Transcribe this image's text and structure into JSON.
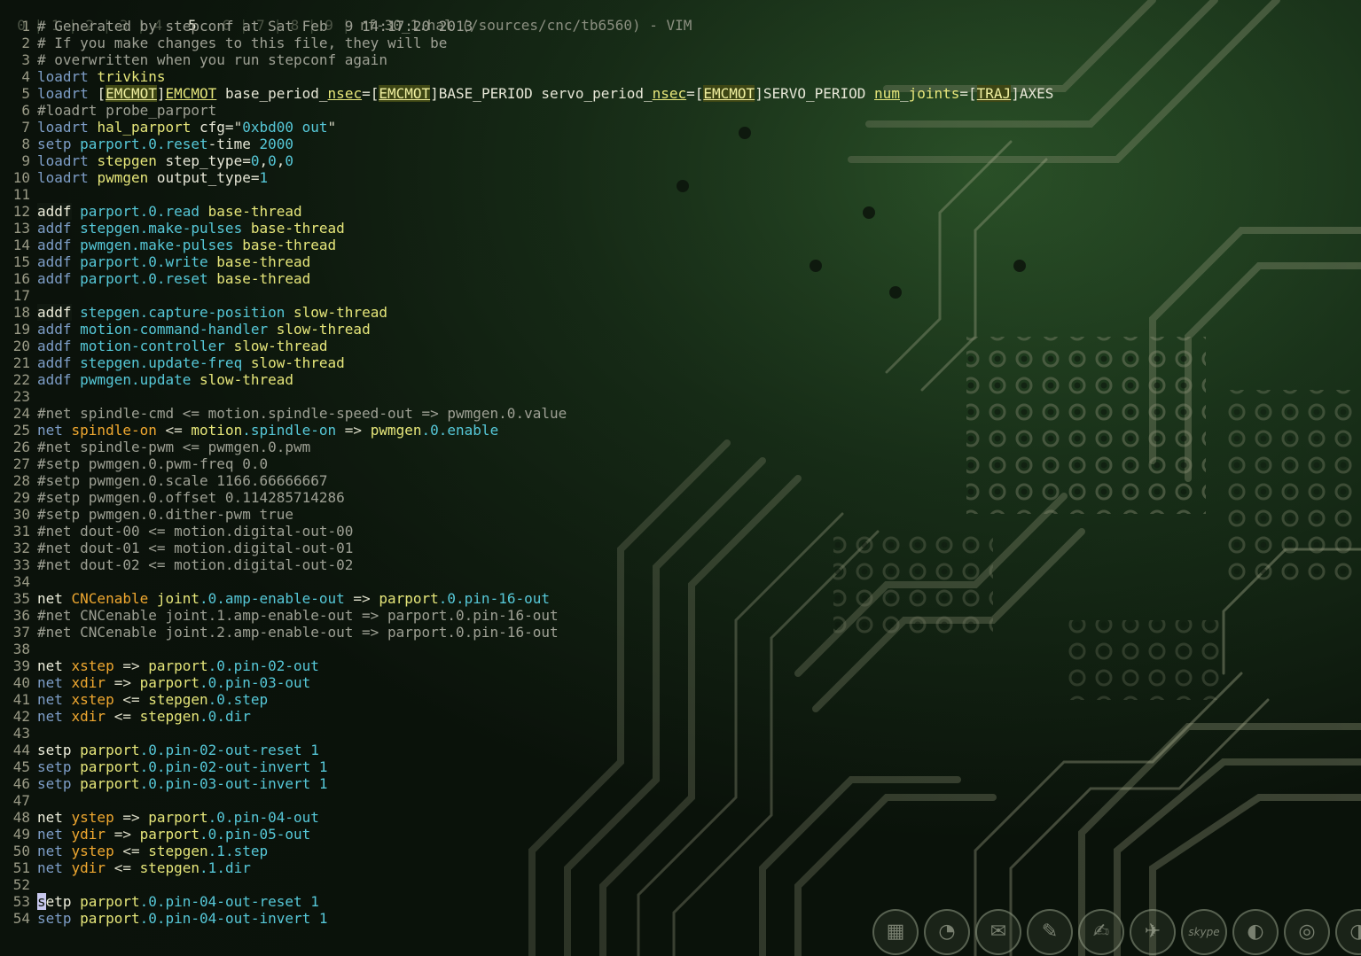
{
  "window": {
    "workspaces": [
      "0",
      "1",
      "2",
      "3",
      "4",
      "5",
      "6",
      "7",
      "8",
      "9"
    ],
    "active_workspace": "5",
    "title": "rf-30_1.hal (/sources/cnc/tb6560) - VIM"
  },
  "editor": {
    "lines": [
      {
        "n": "1",
        "tokens": [
          {
            "t": "# Generated by stepconf at Sat Feb  9 14:17:20 2013",
            "c": "comment"
          }
        ]
      },
      {
        "n": "2",
        "tokens": [
          {
            "t": "# If you make changes to this file, they will be",
            "c": "comment"
          }
        ]
      },
      {
        "n": "3",
        "tokens": [
          {
            "t": "# overwritten when you run stepconf again",
            "c": "comment"
          }
        ]
      },
      {
        "n": "4",
        "tokens": [
          {
            "t": "loadrt ",
            "c": "kw"
          },
          {
            "t": "trivkins",
            "c": "thread"
          }
        ]
      },
      {
        "n": "5",
        "tokens": [
          {
            "t": "loadrt ",
            "c": "kw"
          },
          {
            "t": "[",
            "c": "plain"
          },
          {
            "t": "EMCMOT",
            "c": "hl"
          },
          {
            "t": "]",
            "c": "plain"
          },
          {
            "t": "EMCMOT",
            "c": "ul"
          },
          {
            "t": " base_period_",
            "c": "plain"
          },
          {
            "t": "nsec",
            "c": "ul"
          },
          {
            "t": "=[",
            "c": "plain"
          },
          {
            "t": "EMCMOT",
            "c": "hl"
          },
          {
            "t": "]BASE_PERIOD servo_period_",
            "c": "plain"
          },
          {
            "t": "nsec",
            "c": "ul"
          },
          {
            "t": "=[",
            "c": "plain"
          },
          {
            "t": "EMCMOT",
            "c": "hl"
          },
          {
            "t": "]SERVO_PERIOD ",
            "c": "plain"
          },
          {
            "t": "num",
            "c": "ul"
          },
          {
            "t": "_",
            "c": "plain"
          },
          {
            "t": "joints",
            "c": "thread"
          },
          {
            "t": "=[",
            "c": "plain"
          },
          {
            "t": "TRAJ",
            "c": "hl"
          },
          {
            "t": "]AXES",
            "c": "plain"
          }
        ]
      },
      {
        "n": "6",
        "tokens": [
          {
            "t": "#loadrt probe_parport",
            "c": "comment"
          }
        ]
      },
      {
        "n": "7",
        "tokens": [
          {
            "t": "loadrt ",
            "c": "kw"
          },
          {
            "t": "hal_parport ",
            "c": "thread"
          },
          {
            "t": "cfg=",
            "c": "plain"
          },
          {
            "t": "\"",
            "c": "str"
          },
          {
            "t": "0xbd00 ",
            "c": "num"
          },
          {
            "t": "out",
            "c": "id"
          },
          {
            "t": "\"",
            "c": "str"
          }
        ]
      },
      {
        "n": "8",
        "tokens": [
          {
            "t": "setp ",
            "c": "kw"
          },
          {
            "t": "parport.0.reset",
            "c": "id"
          },
          {
            "t": "-time ",
            "c": "plain"
          },
          {
            "t": "2000",
            "c": "num"
          }
        ]
      },
      {
        "n": "9",
        "tokens": [
          {
            "t": "loadrt ",
            "c": "kw"
          },
          {
            "t": "stepgen ",
            "c": "thread"
          },
          {
            "t": "step_type=",
            "c": "plain"
          },
          {
            "t": "0",
            "c": "num"
          },
          {
            "t": ",",
            "c": "plain"
          },
          {
            "t": "0",
            "c": "num"
          },
          {
            "t": ",",
            "c": "plain"
          },
          {
            "t": "0",
            "c": "num"
          }
        ]
      },
      {
        "n": "10",
        "tokens": [
          {
            "t": "loadrt ",
            "c": "kw"
          },
          {
            "t": "pwmgen ",
            "c": "thread"
          },
          {
            "t": "output_type=",
            "c": "plain"
          },
          {
            "t": "1",
            "c": "num"
          }
        ]
      },
      {
        "n": "11",
        "tokens": []
      },
      {
        "n": "12",
        "tokens": [
          {
            "t": "addf",
            "c": "addf"
          },
          {
            "t": " ",
            "c": "plain"
          },
          {
            "t": "parport.0.read ",
            "c": "id"
          },
          {
            "t": "base-thread",
            "c": "thread"
          }
        ]
      },
      {
        "n": "13",
        "tokens": [
          {
            "t": "addf ",
            "c": "kw"
          },
          {
            "t": "stepgen.make-pulses ",
            "c": "id"
          },
          {
            "t": "base-thread",
            "c": "thread"
          }
        ]
      },
      {
        "n": "14",
        "tokens": [
          {
            "t": "addf ",
            "c": "kw"
          },
          {
            "t": "pwmgen.make-pulses ",
            "c": "id"
          },
          {
            "t": "base-thread",
            "c": "thread"
          }
        ]
      },
      {
        "n": "15",
        "tokens": [
          {
            "t": "addf ",
            "c": "kw"
          },
          {
            "t": "parport.0.write ",
            "c": "id"
          },
          {
            "t": "base-thread",
            "c": "thread"
          }
        ]
      },
      {
        "n": "16",
        "tokens": [
          {
            "t": "addf ",
            "c": "kw"
          },
          {
            "t": "parport.0.reset ",
            "c": "id"
          },
          {
            "t": "base-thread",
            "c": "thread"
          }
        ]
      },
      {
        "n": "17",
        "tokens": []
      },
      {
        "n": "18",
        "tokens": [
          {
            "t": "addf",
            "c": "addf"
          },
          {
            "t": " ",
            "c": "plain"
          },
          {
            "t": "stepgen.capture-position ",
            "c": "id"
          },
          {
            "t": "slow-thread",
            "c": "thread"
          }
        ]
      },
      {
        "n": "19",
        "tokens": [
          {
            "t": "addf ",
            "c": "kw"
          },
          {
            "t": "motion-command-handler ",
            "c": "id"
          },
          {
            "t": "slow-thread",
            "c": "thread"
          }
        ]
      },
      {
        "n": "20",
        "tokens": [
          {
            "t": "addf ",
            "c": "kw"
          },
          {
            "t": "motion-controller ",
            "c": "id"
          },
          {
            "t": "slow-thread",
            "c": "thread"
          }
        ]
      },
      {
        "n": "21",
        "tokens": [
          {
            "t": "addf ",
            "c": "kw"
          },
          {
            "t": "stepgen.update-freq ",
            "c": "id"
          },
          {
            "t": "slow-thread",
            "c": "thread"
          }
        ]
      },
      {
        "n": "22",
        "tokens": [
          {
            "t": "addf ",
            "c": "kw"
          },
          {
            "t": "pwmgen.update ",
            "c": "id"
          },
          {
            "t": "slow-thread",
            "c": "thread"
          }
        ]
      },
      {
        "n": "23",
        "tokens": []
      },
      {
        "n": "24",
        "tokens": [
          {
            "t": "#net spindle-cmd <= motion.spindle-speed-out => pwmgen.0.value",
            "c": "comment"
          }
        ]
      },
      {
        "n": "25",
        "tokens": [
          {
            "t": "net ",
            "c": "kw"
          },
          {
            "t": "spindle-on ",
            "c": "sig"
          },
          {
            "t": "<= ",
            "c": "op"
          },
          {
            "t": "motion",
            "c": "thread"
          },
          {
            "t": ".spindle-on ",
            "c": "id"
          },
          {
            "t": "=> ",
            "c": "op"
          },
          {
            "t": "pwmgen",
            "c": "thread"
          },
          {
            "t": ".0.enable",
            "c": "id"
          }
        ]
      },
      {
        "n": "26",
        "tokens": [
          {
            "t": "#net spindle-pwm <= pwmgen.0.pwm",
            "c": "comment"
          }
        ]
      },
      {
        "n": "27",
        "tokens": [
          {
            "t": "#setp pwmgen.0.pwm-freq 0.0",
            "c": "comment"
          }
        ]
      },
      {
        "n": "28",
        "tokens": [
          {
            "t": "#setp pwmgen.0.scale 1166.66666667",
            "c": "comment"
          }
        ]
      },
      {
        "n": "29",
        "tokens": [
          {
            "t": "#setp pwmgen.0.offset 0.114285714286",
            "c": "comment"
          }
        ]
      },
      {
        "n": "30",
        "tokens": [
          {
            "t": "#setp pwmgen.0.dither-pwm true",
            "c": "comment"
          }
        ]
      },
      {
        "n": "31",
        "tokens": [
          {
            "t": "#net dout-00 <= motion.digital-out-00",
            "c": "comment"
          }
        ]
      },
      {
        "n": "32",
        "tokens": [
          {
            "t": "#net dout-01 <= motion.digital-out-01",
            "c": "comment"
          }
        ]
      },
      {
        "n": "33",
        "tokens": [
          {
            "t": "#net dout-02 <= motion.digital-out-02",
            "c": "comment"
          }
        ]
      },
      {
        "n": "34",
        "tokens": []
      },
      {
        "n": "35",
        "tokens": [
          {
            "t": "net ",
            "c": "cmd"
          },
          {
            "t": "CNCenable ",
            "c": "sig"
          },
          {
            "t": "joint",
            "c": "thread"
          },
          {
            "t": ".0.amp-enable-out ",
            "c": "id"
          },
          {
            "t": "=> ",
            "c": "op"
          },
          {
            "t": "parport",
            "c": "thread"
          },
          {
            "t": ".0.pin-16-out",
            "c": "id"
          }
        ]
      },
      {
        "n": "36",
        "tokens": [
          {
            "t": "#net CNCenable joint.1.amp-enable-out => parport.0.pin-16-out",
            "c": "comment"
          }
        ]
      },
      {
        "n": "37",
        "tokens": [
          {
            "t": "#net CNCenable joint.2.amp-enable-out => parport.0.pin-16-out",
            "c": "comment"
          }
        ]
      },
      {
        "n": "38",
        "tokens": []
      },
      {
        "n": "39",
        "tokens": [
          {
            "t": "net ",
            "c": "cmd"
          },
          {
            "t": "xstep ",
            "c": "sig"
          },
          {
            "t": "=> ",
            "c": "op"
          },
          {
            "t": "parport",
            "c": "thread"
          },
          {
            "t": ".0.pin-02-out",
            "c": "id"
          }
        ]
      },
      {
        "n": "40",
        "tokens": [
          {
            "t": "net ",
            "c": "kw"
          },
          {
            "t": "xdir ",
            "c": "sig"
          },
          {
            "t": "=> ",
            "c": "op"
          },
          {
            "t": "parport",
            "c": "thread"
          },
          {
            "t": ".0.pin-03-out",
            "c": "id"
          }
        ]
      },
      {
        "n": "41",
        "tokens": [
          {
            "t": "net ",
            "c": "kw"
          },
          {
            "t": "xstep ",
            "c": "sig"
          },
          {
            "t": "<= ",
            "c": "op"
          },
          {
            "t": "stepgen",
            "c": "thread"
          },
          {
            "t": ".0.step",
            "c": "id"
          }
        ]
      },
      {
        "n": "42",
        "tokens": [
          {
            "t": "net ",
            "c": "kw"
          },
          {
            "t": "xdir ",
            "c": "sig"
          },
          {
            "t": "<= ",
            "c": "op"
          },
          {
            "t": "stepgen",
            "c": "thread"
          },
          {
            "t": ".0.dir",
            "c": "id"
          }
        ]
      },
      {
        "n": "43",
        "tokens": []
      },
      {
        "n": "44",
        "tokens": [
          {
            "t": "setp ",
            "c": "cmd"
          },
          {
            "t": "parport",
            "c": "thread"
          },
          {
            "t": ".0.pin-02-out-reset ",
            "c": "id"
          },
          {
            "t": "1",
            "c": "num"
          }
        ]
      },
      {
        "n": "45",
        "tokens": [
          {
            "t": "setp ",
            "c": "kw"
          },
          {
            "t": "parport",
            "c": "thread"
          },
          {
            "t": ".0.pin-02-out-invert ",
            "c": "id"
          },
          {
            "t": "1",
            "c": "num"
          }
        ]
      },
      {
        "n": "46",
        "tokens": [
          {
            "t": "setp ",
            "c": "kw"
          },
          {
            "t": "parport",
            "c": "thread"
          },
          {
            "t": ".0.pin-03-out-invert ",
            "c": "id"
          },
          {
            "t": "1",
            "c": "num"
          }
        ]
      },
      {
        "n": "47",
        "tokens": []
      },
      {
        "n": "48",
        "tokens": [
          {
            "t": "net ",
            "c": "cmd"
          },
          {
            "t": "ystep ",
            "c": "sig"
          },
          {
            "t": "=> ",
            "c": "op"
          },
          {
            "t": "parport",
            "c": "thread"
          },
          {
            "t": ".0.pin-04-out",
            "c": "id"
          }
        ]
      },
      {
        "n": "49",
        "tokens": [
          {
            "t": "net ",
            "c": "kw"
          },
          {
            "t": "ydir ",
            "c": "sig"
          },
          {
            "t": "=> ",
            "c": "op"
          },
          {
            "t": "parport",
            "c": "thread"
          },
          {
            "t": ".0.pin-05-out",
            "c": "id"
          }
        ]
      },
      {
        "n": "50",
        "tokens": [
          {
            "t": "net ",
            "c": "kw"
          },
          {
            "t": "ystep ",
            "c": "sig"
          },
          {
            "t": "<= ",
            "c": "op"
          },
          {
            "t": "stepgen",
            "c": "thread"
          },
          {
            "t": ".1.step",
            "c": "id"
          }
        ]
      },
      {
        "n": "51",
        "tokens": [
          {
            "t": "net ",
            "c": "kw"
          },
          {
            "t": "ydir ",
            "c": "sig"
          },
          {
            "t": "<= ",
            "c": "op"
          },
          {
            "t": "stepgen",
            "c": "thread"
          },
          {
            "t": ".1.dir",
            "c": "id"
          }
        ]
      },
      {
        "n": "52",
        "tokens": []
      },
      {
        "n": "53",
        "tokens": [
          {
            "t": "s",
            "c": "cursor"
          },
          {
            "t": "etp ",
            "c": "cmd"
          },
          {
            "t": "parport",
            "c": "thread"
          },
          {
            "t": ".0.pin-04-out-reset ",
            "c": "id"
          },
          {
            "t": "1",
            "c": "num"
          }
        ]
      },
      {
        "n": "54",
        "tokens": [
          {
            "t": "setp ",
            "c": "kw"
          },
          {
            "t": "parport",
            "c": "thread"
          },
          {
            "t": ".0.pin-04-out-invert ",
            "c": "id"
          },
          {
            "t": "1",
            "c": "num"
          }
        ]
      }
    ]
  },
  "dock": {
    "icons": [
      {
        "name": "grid-icon",
        "glyph": "▦"
      },
      {
        "name": "browser-icon",
        "glyph": "◔"
      },
      {
        "name": "mail-icon",
        "glyph": "✉"
      },
      {
        "name": "pencil-icon",
        "glyph": "✎"
      },
      {
        "name": "editor-icon",
        "glyph": "✍"
      },
      {
        "name": "pin-icon",
        "glyph": "✈"
      },
      {
        "name": "skype-icon",
        "glyph": "skype"
      },
      {
        "name": "firefox-icon",
        "glyph": "◐"
      },
      {
        "name": "chrome-icon",
        "glyph": "◎"
      },
      {
        "name": "chat-icon",
        "glyph": "◑"
      }
    ]
  },
  "colors": {
    "background": "#0b120b",
    "pcb_trace": "#a8ad8e",
    "pcb_board": "#1e3a1e",
    "comment": "#9ea094",
    "keyword": "#7e9ec8",
    "identifier": "#56c8d8",
    "signal": "#f0a830",
    "thread": "#e6e67a"
  }
}
